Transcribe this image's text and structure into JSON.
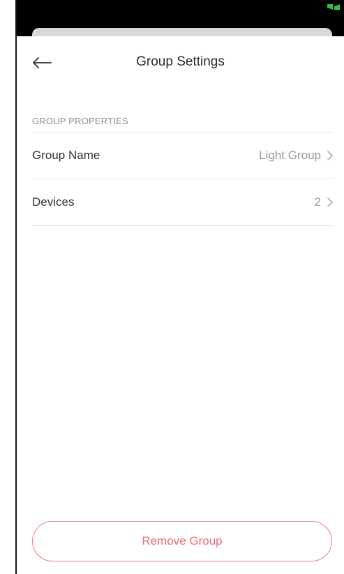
{
  "header": {
    "title": "Group Settings"
  },
  "icons": {
    "back": "arrow-left-icon",
    "status": "battery-charging-icon",
    "chevron": "chevron-right-icon"
  },
  "colors": {
    "danger": "#ef6e6e",
    "status_green": "#35c24a",
    "secondary_text": "#9a9a9a"
  },
  "section": {
    "title": "GROUP PROPERTIES",
    "rows": [
      {
        "label": "Group Name",
        "value": "Light Group"
      },
      {
        "label": "Devices",
        "value": "2"
      }
    ]
  },
  "actions": {
    "remove_label": "Remove Group"
  }
}
